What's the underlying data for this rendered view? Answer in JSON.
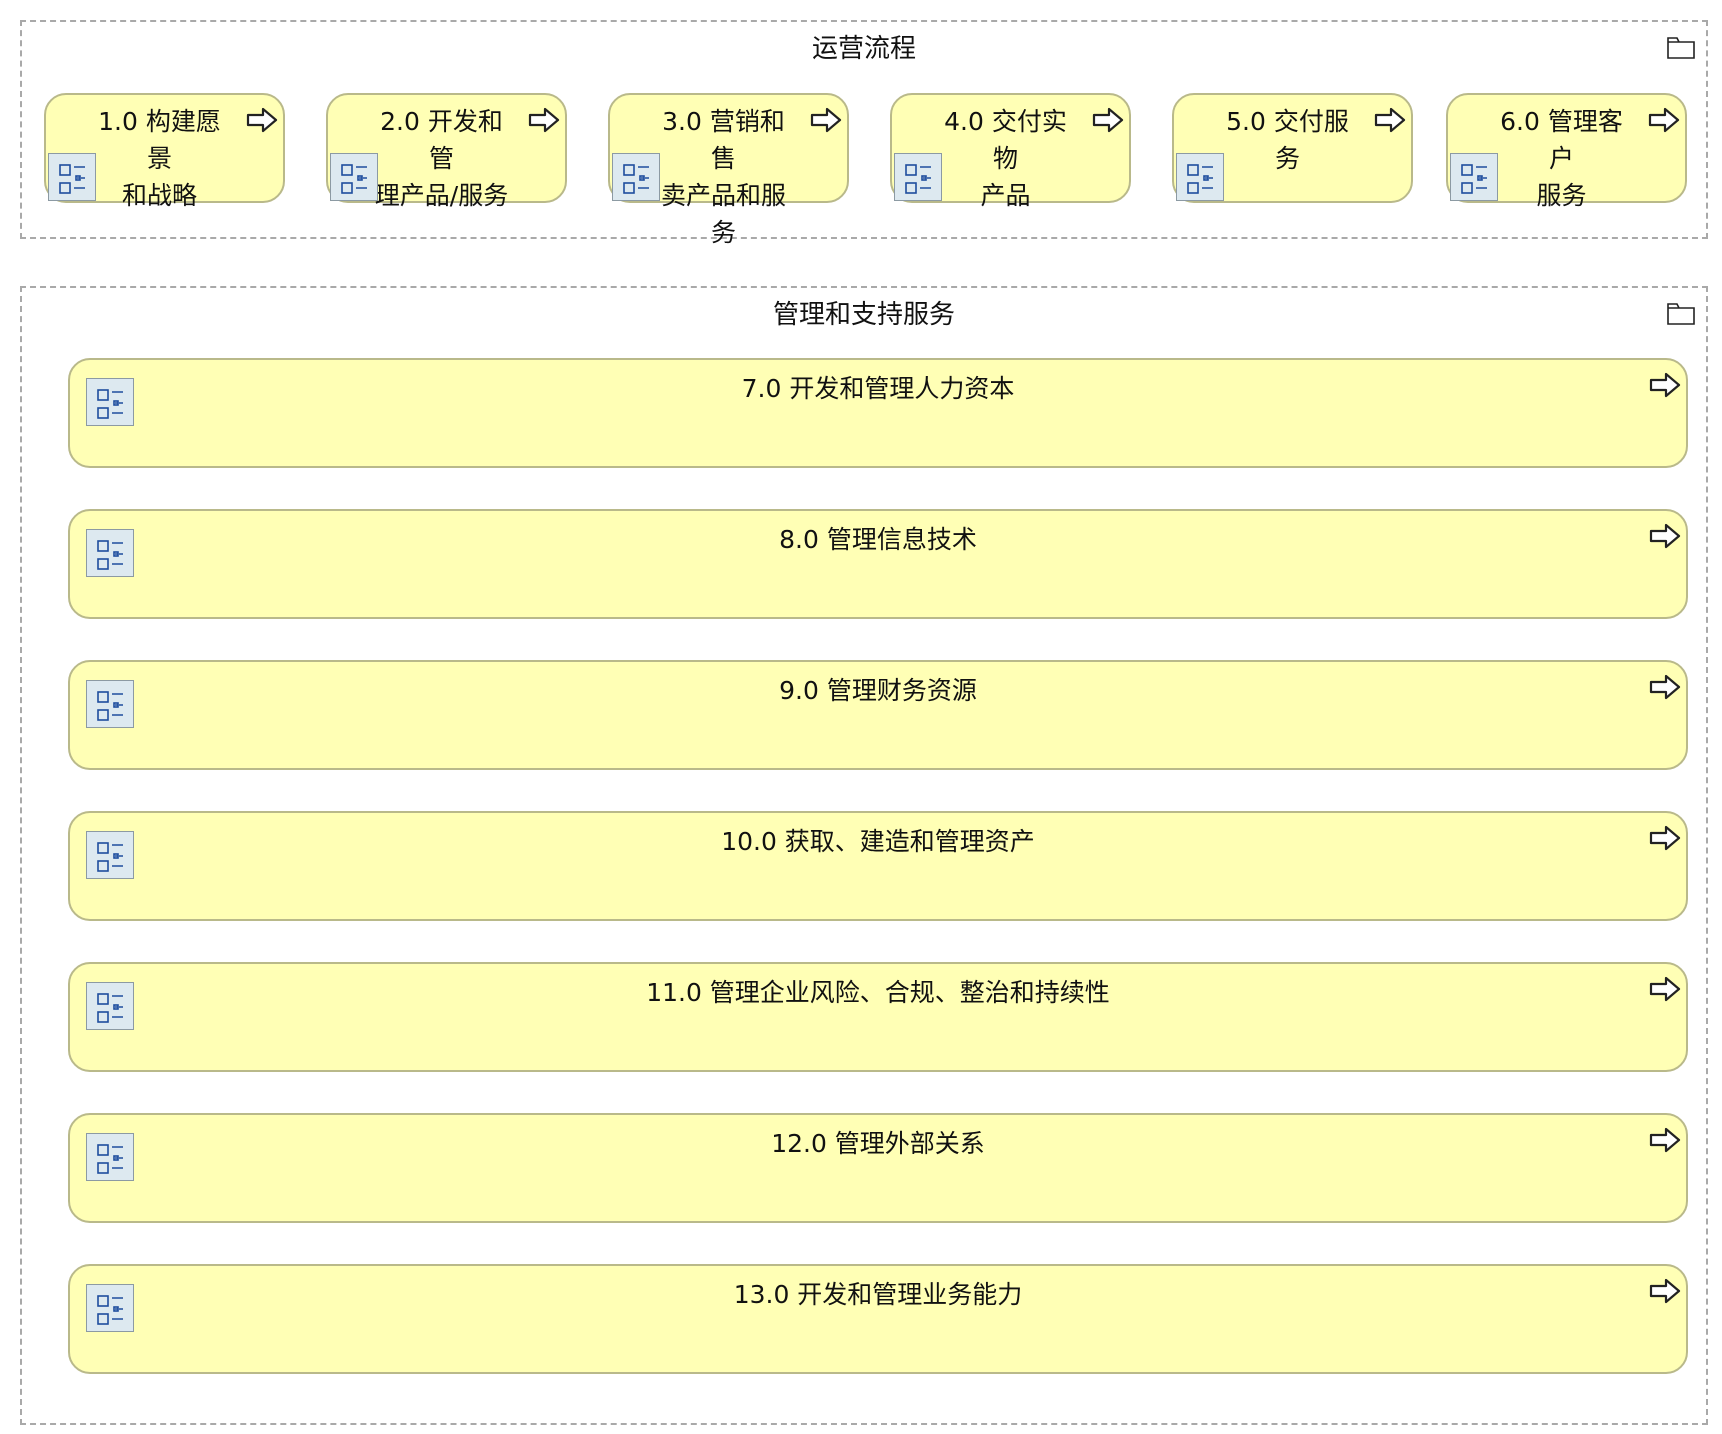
{
  "operations": {
    "title": "运营流程",
    "folder_icon": "folder-icon",
    "processes": [
      {
        "label": "1.0 构建愿景\n和战略",
        "icon": "process-tree-icon",
        "arrow": "arrow-right-icon"
      },
      {
        "label": "2.0 开发和管\n理产品/服务",
        "icon": "process-tree-icon",
        "arrow": "arrow-right-icon"
      },
      {
        "label": "3.0 营销和售\n卖产品和服务",
        "icon": "process-tree-icon",
        "arrow": "arrow-right-icon"
      },
      {
        "label": "4.0 交付实物\n产品",
        "icon": "process-tree-icon",
        "arrow": "arrow-right-icon"
      },
      {
        "label": "5.0 交付服务",
        "icon": "process-tree-icon",
        "arrow": "arrow-right-icon"
      },
      {
        "label": "6.0 管理客户\n服务",
        "icon": "process-tree-icon",
        "arrow": "arrow-right-icon"
      }
    ]
  },
  "support": {
    "title": "管理和支持服务",
    "folder_icon": "folder-icon",
    "processes": [
      {
        "label": "7.0 开发和管理人力资本",
        "icon": "process-tree-icon",
        "arrow": "arrow-right-icon"
      },
      {
        "label": "8.0 管理信息技术",
        "icon": "process-tree-icon",
        "arrow": "arrow-right-icon"
      },
      {
        "label": "9.0 管理财务资源",
        "icon": "process-tree-icon",
        "arrow": "arrow-right-icon"
      },
      {
        "label": "10.0 获取、建造和管理资产",
        "icon": "process-tree-icon",
        "arrow": "arrow-right-icon"
      },
      {
        "label": "11.0 管理企业风险、合规、整治和持续性",
        "icon": "process-tree-icon",
        "arrow": "arrow-right-icon"
      },
      {
        "label": "12.0 管理外部关系",
        "icon": "process-tree-icon",
        "arrow": "arrow-right-icon"
      },
      {
        "label": "13.0 开发和管理业务能力",
        "icon": "process-tree-icon",
        "arrow": "arrow-right-icon"
      }
    ]
  },
  "colors": {
    "box_fill": "#ffffb5",
    "box_border": "#b9b98a",
    "icon_fill": "#dde9f0",
    "icon_stroke": "#1f4e9e",
    "group_border": "#a9a9a9"
  }
}
